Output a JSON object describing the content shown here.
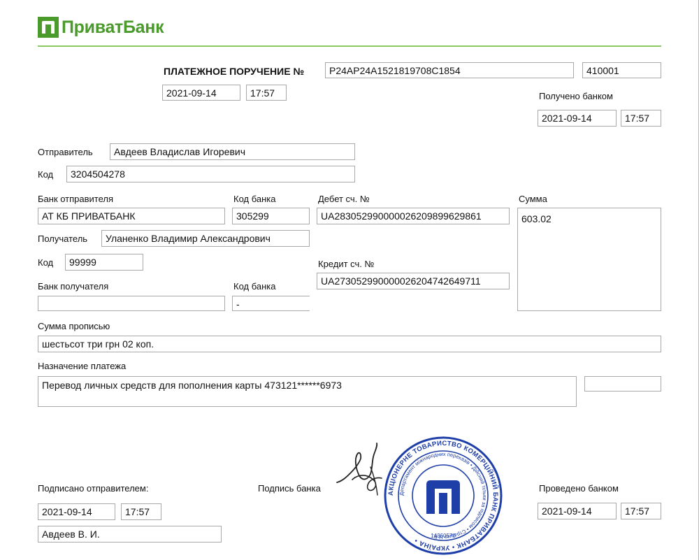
{
  "header": {
    "bank_name": "ПриватБанк",
    "brand_color": "#4a9a2c",
    "line_color": "#8cc760",
    "logo_icon": "privatbank-logo-icon"
  },
  "order": {
    "title": "ПЛАТЕЖНОЕ ПОРУЧЕНИЕ №",
    "number": "P24AP24A1521819708C1854",
    "code": "410001",
    "date": "2021-09-14",
    "time": "17:57"
  },
  "received": {
    "label": "Получено банком",
    "date": "2021-09-14",
    "time": "17:57"
  },
  "sender": {
    "label": "Отправитель",
    "name": "Авдеев Владислав Игоревич",
    "code_label": "Код",
    "code": "3204504278",
    "bank_label": "Банк отправителя",
    "bank": "АТ КБ ПРИВАТБАНК",
    "bank_code_label": "Код банка",
    "bank_code": "305299",
    "debit_label": "Дебет сч. №",
    "debit": "UA283052990000026209899629861"
  },
  "amount": {
    "label": "Сумма",
    "value": "603.02"
  },
  "recipient": {
    "label": "Получатель",
    "name": "Уланенко Владимир Александрович",
    "code_label": "Код",
    "code": "99999",
    "credit_label": "Кредит сч. №",
    "credit": "UA273052990000026204742649711",
    "bank_label": "Банк получателя",
    "bank": "",
    "bank_code_label": "Код банка",
    "bank_code": "-"
  },
  "amount_words": {
    "label": "Сумма прописью",
    "value": "шестьсот три грн 02 коп."
  },
  "purpose": {
    "label": "Назначение платежа",
    "value": "Перевод личных средств для пополнения карты 473121******6973",
    "extra": ""
  },
  "signed": {
    "label": "Подписано отправителем:",
    "date": "2021-09-14",
    "time": "17:57",
    "name": "Авдеев В. И."
  },
  "bank_signature": {
    "label": "Подпись банка"
  },
  "stamp": {
    "color": "#1f3fa8",
    "outer_text": "АКЦІОНЕРНЕ ТОВАРИСТВО КОМЕРЦІЙНИЙ БАНК ПРИВАТБАНК • УКРАЇНА •",
    "inner_text": "Департамент міжнародних переказів • Дійсний тільки за підписом • Страшко Н.В.",
    "code": "14360570"
  },
  "processed": {
    "label": "Проведено банком",
    "date": "2021-09-14",
    "time": "17:57"
  }
}
